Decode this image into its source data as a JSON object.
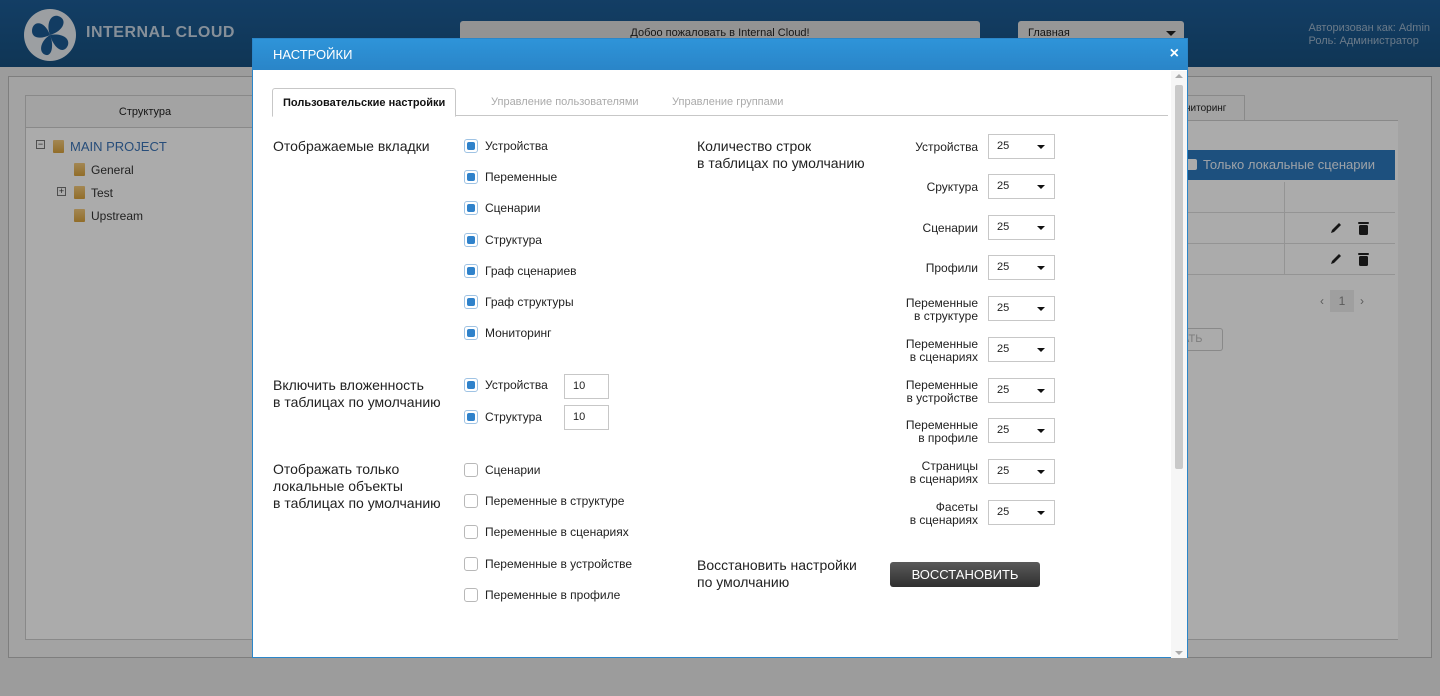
{
  "app": {
    "logo_text": "INTERNAL CLOUD",
    "welcome": "Добоо пожаловать в Internal Cloud!",
    "nav_select": "Главная",
    "user_line1": "Авторизован как: Admin",
    "user_line2": "Роль: Администратор"
  },
  "structure": {
    "header": "Структура",
    "items": [
      "MAIN PROJECT",
      "General",
      "Test",
      "Upstream"
    ]
  },
  "right_panel": {
    "tab": "ниторинг",
    "checkbox_label": "Только локальные сценарии",
    "page": "1",
    "ghost_button": "АТЬ"
  },
  "modal": {
    "title": "НАСТРОЙКИ",
    "close": "×",
    "tabs": [
      "Пользовательские настройки",
      "Управление пользователями",
      "Управление группами"
    ],
    "visible_tabs": {
      "label": "Отображаемые вкладки",
      "options": [
        {
          "label": "Устройства",
          "checked": true
        },
        {
          "label": "Переменные",
          "checked": true
        },
        {
          "label": "Сценарии",
          "checked": true
        },
        {
          "label": "Структура",
          "checked": true
        },
        {
          "label": "Граф сценариев",
          "checked": true
        },
        {
          "label": "Граф структуры",
          "checked": true
        },
        {
          "label": "Мониторинг",
          "checked": true
        }
      ]
    },
    "nesting": {
      "label_line1": "Включить вложенность",
      "label_line2": "в таблицах по умолчанию",
      "options": [
        {
          "label": "Устройства",
          "checked": true,
          "value": "10"
        },
        {
          "label": "Структура",
          "checked": true,
          "value": "10"
        }
      ]
    },
    "local_only": {
      "label_line1": "Отображать только",
      "label_line2": "локальные объекты",
      "label_line3": "в таблицах по умолчанию",
      "options": [
        {
          "label": "Сценарии",
          "checked": false
        },
        {
          "label": "Переменные в структуре",
          "checked": false
        },
        {
          "label": "Переменные в сценариях",
          "checked": false
        },
        {
          "label": "Переменные в устройстве",
          "checked": false
        },
        {
          "label": "Переменные в профиле",
          "checked": false
        }
      ]
    },
    "rows_count": {
      "label_line1": "Количество строк",
      "label_line2": "в таблицах по умолчанию",
      "rows": [
        {
          "line1": "",
          "line2": "Устройства",
          "value": "25"
        },
        {
          "line1": "",
          "line2": "Сруктура",
          "value": "25"
        },
        {
          "line1": "",
          "line2": "Сценарии",
          "value": "25"
        },
        {
          "line1": "",
          "line2": "Профили",
          "value": "25"
        },
        {
          "line1": "Переменные",
          "line2": "в структуре",
          "value": "25"
        },
        {
          "line1": "Переменные",
          "line2": "в сценариях",
          "value": "25"
        },
        {
          "line1": "Переменные",
          "line2": "в устройстве",
          "value": "25"
        },
        {
          "line1": "Переменные",
          "line2": "в профиле",
          "value": "25"
        },
        {
          "line1": "Страницы",
          "line2": "в сценариях",
          "value": "25"
        },
        {
          "line1": "Фасеты",
          "line2": "в сценариях",
          "value": "25"
        }
      ]
    },
    "restore": {
      "label_line1": "Восстановить настройки",
      "label_line2": "по умолчанию",
      "button": "ВОССТАНОВИТЬ"
    }
  }
}
